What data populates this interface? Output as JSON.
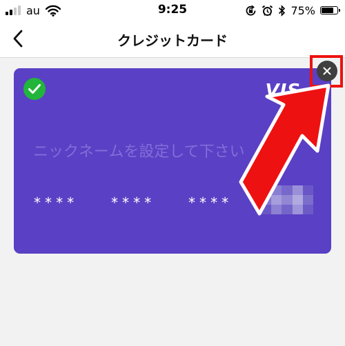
{
  "status_bar": {
    "carrier": "au",
    "time": "9:25",
    "battery_percent": "75%",
    "battery_level": 0.75,
    "icons": [
      "signal-icon",
      "wifi-icon",
      "orientation-lock-icon",
      "alarm-icon",
      "bluetooth-icon",
      "battery-icon"
    ]
  },
  "nav": {
    "title": "クレジットカード",
    "back_icon": "chevron-left-icon"
  },
  "card": {
    "brand": "VIS",
    "nickname_placeholder": "ニックネームを設定して下さい",
    "masked_groups": [
      "****",
      "****",
      "****"
    ],
    "selected_icon": "checkmark-icon",
    "close_icon": "close-icon",
    "colors": {
      "card": "#5a40c4",
      "check": "#22b53b",
      "close": "#3f3f3f"
    }
  },
  "annotation": {
    "color": "#ee1111",
    "shapes": [
      "highlight-box",
      "arrow"
    ]
  }
}
